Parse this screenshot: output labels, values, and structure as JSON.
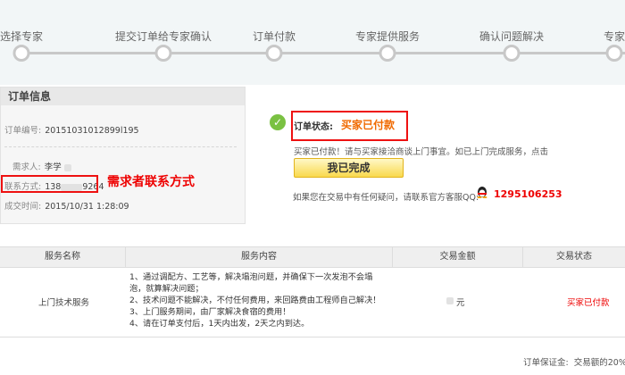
{
  "steps": [
    "选择专家",
    "提交订单给专家确认",
    "订单付款",
    "专家提供服务",
    "确认问题解决",
    "专家"
  ],
  "order_info": {
    "title": "订单信息",
    "order_no_label": "订单编号:",
    "order_no": "20151031012899l195",
    "requester_label": "需求人:",
    "requester_value": "李学",
    "contact_label": "联系方式:",
    "contact_prefix": "138",
    "contact_suffix": "9264",
    "time_label": "成交时间:",
    "time_value": "2015/10/31 1:28:09"
  },
  "annotation": "需求者联系方式",
  "status": {
    "label": "订单状态:",
    "value": "买家已付款",
    "desc": "买家已付款！请与买家接洽商谈上门事宜。如已上门完成服务，点击",
    "button": "我已完成",
    "help": "如果您在交易中有任何疑问，请联系官方客服QQ:",
    "qq": "1295106253"
  },
  "table": {
    "headers": [
      "服务名称",
      "服务内容",
      "交易金额",
      "交易状态"
    ],
    "row": {
      "name": "上门技术服务",
      "content": [
        "1、通过调配方、工艺等，解决塌泡问题，并确保下一次发泡不会塌",
        "泡，就算解决问题；",
        "2、技术问题不能解决，不付任何费用，来回路费由工程师自己解决！",
        "3、上门服务期间，由厂家解决食宿的费用！",
        "4、请在订单支付后，1天内出发，2天之内到达。"
      ],
      "amount_unit": "元",
      "status": "买家已付款"
    }
  },
  "footer": {
    "label": "订单保证金:",
    "value": "交易额的20%"
  },
  "colors": {
    "accent_orange": "#f06a00",
    "annotation_red": "#e00000",
    "check_green": "#7ac142"
  }
}
